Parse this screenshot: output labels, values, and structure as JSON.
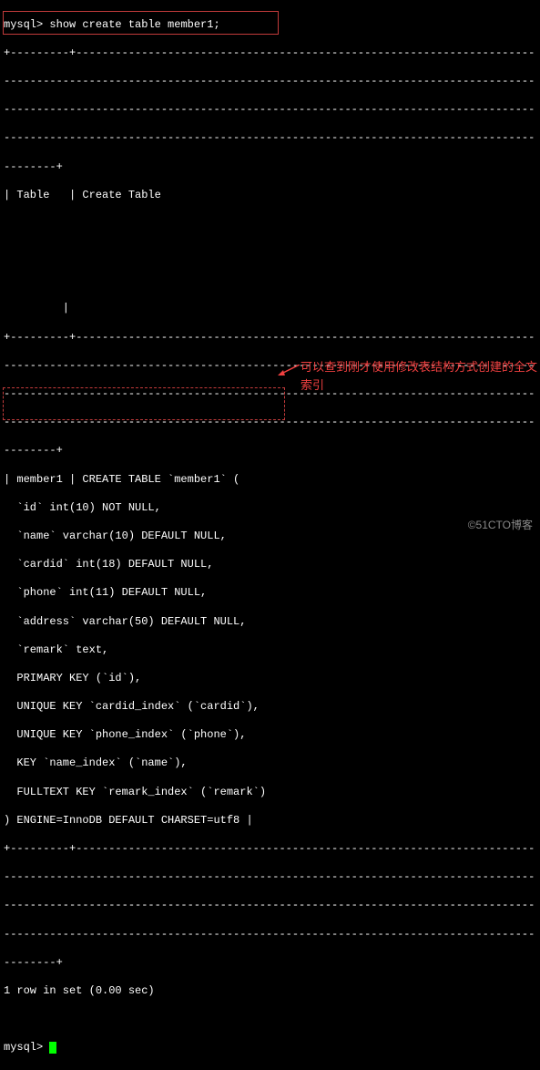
{
  "prompt1": "mysql> ",
  "command": "show create table member1;",
  "dashline": "+---------+------------------------------------------------------------------------------------",
  "dashcont": "---------------------------------------------------------------------------------------------",
  "dashcont2": "---------------------------------------------------------------------------------------------",
  "dashend": "--------+",
  "header": "| Table   | Create Table",
  "blankpipe": "         |",
  "row_start": "| member1 | CREATE TABLE `member1` (",
  "col_id": "  `id` int(10) NOT NULL,",
  "col_name": "  `name` varchar(10) DEFAULT NULL,",
  "col_cardid": "  `cardid` int(18) DEFAULT NULL,",
  "col_phone": "  `phone` int(11) DEFAULT NULL,",
  "col_address": "  `address` varchar(50) DEFAULT NULL,",
  "col_remark": "  `remark` text,",
  "pk": "  PRIMARY KEY (`id`),",
  "uk1": "  UNIQUE KEY `cardid_index` (`cardid`),",
  "uk2": "  UNIQUE KEY `phone_index` (`phone`),",
  "key_name": "  KEY `name_index` (`name`),",
  "ftkey": "  FULLTEXT KEY `remark_index` (`remark`)",
  "engine": ") ENGINE=InnoDB DEFAULT CHARSET=utf8 |",
  "rows_msg": "1 row in set (0.00 sec)",
  "prompt2": "mysql> ",
  "annotation": "可以查到刚才使用修改表结构方式创建的全文索引",
  "watermark": "©51CTO博客"
}
